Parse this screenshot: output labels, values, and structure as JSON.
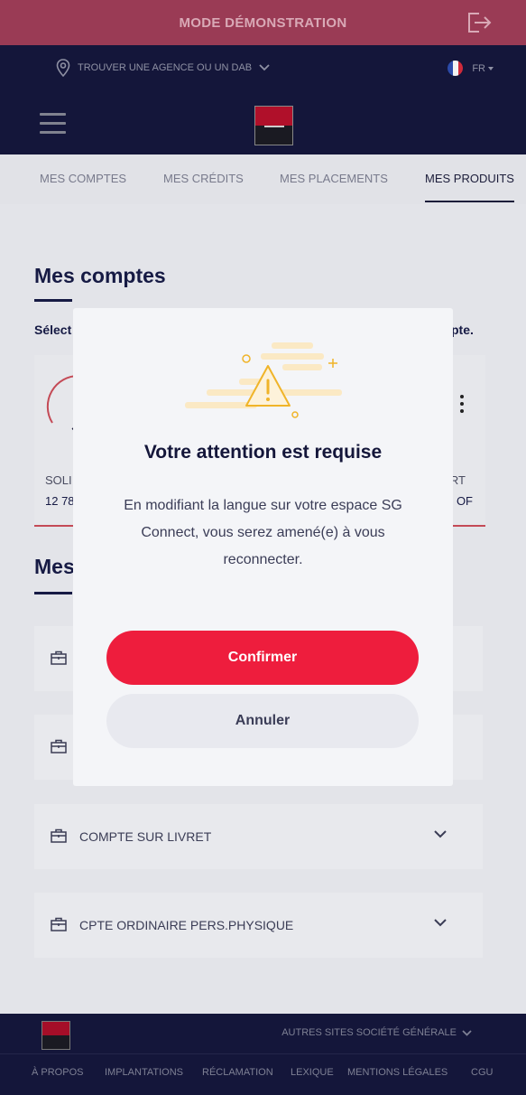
{
  "demo_bar": {
    "title": "MODE DÉMONSTRATION",
    "logout_icon": "logout-icon"
  },
  "agency_bar": {
    "find_agency": "TROUVER UNE AGENCE OU UN DAB",
    "language": "FR"
  },
  "tabs": [
    {
      "label": "MES COMPTES"
    },
    {
      "label": "MES CRÉDITS"
    },
    {
      "label": "MES PLACEMENTS"
    },
    {
      "label": "MES PRODUITS",
      "active": true
    }
  ],
  "accounts_section": {
    "title": "Mes comptes",
    "hint_start": "Sélect",
    "hint_end": "pte.",
    "card": {
      "label_left": "SOLI",
      "value_left": "12 78",
      "label_right": "RT",
      "value_right": "OF"
    }
  },
  "products_section": {
    "title": "Mes",
    "items": [
      {
        "label": ""
      },
      {
        "label": ""
      },
      {
        "label": "COMPTE SUR LIVRET"
      },
      {
        "label": "CPTE ORDINAIRE PERS.PHYSIQUE"
      }
    ]
  },
  "footer": {
    "other_sites": "AUTRES SITES SOCIÉTÉ GÉNÉRALE",
    "links": [
      "À PROPOS",
      "IMPLANTATIONS",
      "RÉCLAMATION",
      "LEXIQUE",
      "MENTIONS LÉGALES",
      "CGU"
    ]
  },
  "modal": {
    "title": "Votre attention est requise",
    "message": "En modifiant la langue sur votre espace SG Connect, vous serez amené(e) à vous reconnecter.",
    "confirm_label": "Confirmer",
    "cancel_label": "Annuler",
    "illustration_icon": "warning-icon"
  },
  "colors": {
    "accent": "#ee1d3d",
    "navy": "#14163a",
    "demo": "#9a3b55"
  }
}
